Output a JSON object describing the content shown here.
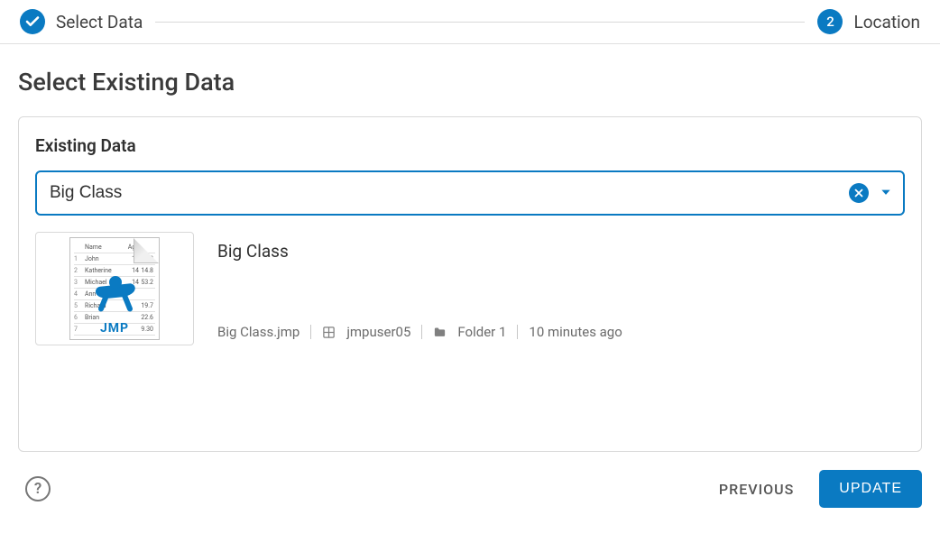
{
  "stepper": {
    "step1": {
      "label": "Select Data",
      "state": "complete"
    },
    "step2": {
      "label": "Location",
      "number": "2",
      "state": "active"
    }
  },
  "page": {
    "title": "Select Existing Data"
  },
  "panel": {
    "title": "Existing Data"
  },
  "combo": {
    "value": "Big Class"
  },
  "result": {
    "title": "Big Class",
    "filename": "Big Class.jmp",
    "user": "jmpuser05",
    "folder": "Folder 1",
    "time": "10 minutes ago",
    "thumb_logo": "JMP",
    "thumb_columns": [
      "",
      "Name",
      "Age",
      "Ht"
    ],
    "thumb_rows": [
      [
        "1",
        "John",
        "13",
        "18"
      ],
      [
        "2",
        "Katherine",
        "14",
        "14.8"
      ],
      [
        "3",
        "Michael",
        "14",
        "53.2"
      ],
      [
        "4",
        "Ann",
        "",
        ""
      ],
      [
        "5",
        "Richard",
        "",
        "19.7"
      ],
      [
        "6",
        "Brian",
        "",
        "22.6"
      ],
      [
        "7",
        "",
        "",
        "9.30"
      ]
    ]
  },
  "footer": {
    "help": "?",
    "previous": "PREVIOUS",
    "update": "UPDATE"
  }
}
